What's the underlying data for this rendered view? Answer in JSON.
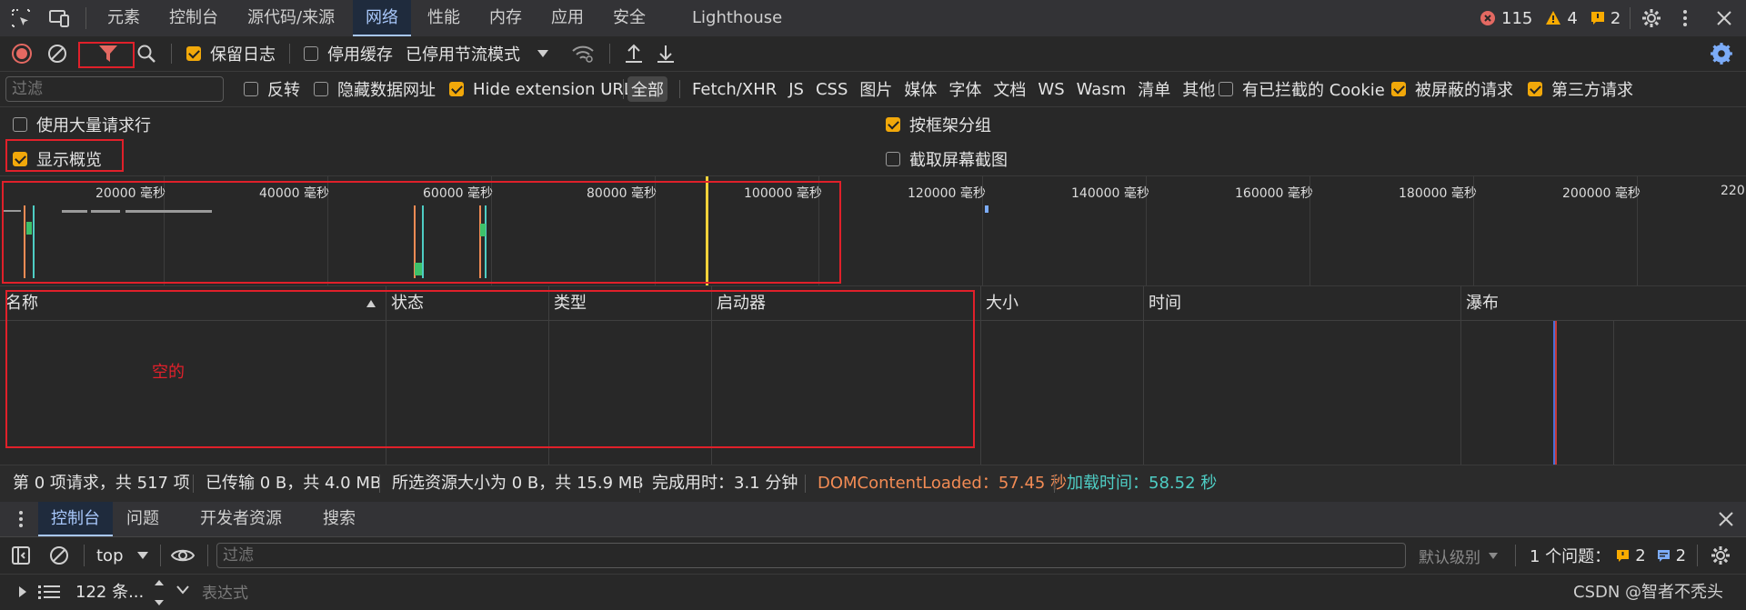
{
  "tabs": [
    {
      "label": "元素"
    },
    {
      "label": "控制台"
    },
    {
      "label": "源代码/来源"
    },
    {
      "label": "网络"
    },
    {
      "label": "性能"
    },
    {
      "label": "内存"
    },
    {
      "label": "应用"
    },
    {
      "label": "安全"
    },
    {
      "label": "Lighthouse"
    }
  ],
  "badges": {
    "errors": "115",
    "warnings": "4",
    "info": "2"
  },
  "toolbar": {
    "preserve_log": "保留日志",
    "disable_cache": "停用缓存",
    "throttle": "已停用节流模式"
  },
  "filter": {
    "placeholder": "过滤",
    "invert": "反转",
    "hide_data_urls": "隐藏数据网址",
    "hide_ext": "Hide extension URLs",
    "types": [
      "全部",
      "Fetch/XHR",
      "JS",
      "CSS",
      "图片",
      "媒体",
      "字体",
      "文档",
      "WS",
      "Wasm",
      "清单",
      "其他"
    ],
    "blocked_cookies": "有已拦截的 Cookie",
    "blocked_requests": "被屏蔽的请求",
    "third_party": "第三方请求"
  },
  "options": {
    "large_rows": "使用大量请求行",
    "group_by_frame": "按框架分组",
    "show_overview": "显示概览",
    "capture_screenshots": "截取屏幕截图"
  },
  "overview": {
    "ticks": [
      "20000 毫秒",
      "40000 毫秒",
      "60000 毫秒",
      "80000 毫秒",
      "100000 毫秒",
      "120000 毫秒",
      "140000 毫秒",
      "160000 毫秒",
      "180000 毫秒",
      "200000 毫秒",
      "220"
    ]
  },
  "table": {
    "headers": [
      "名称",
      "状态",
      "类型",
      "启动器",
      "大小",
      "时间",
      "瀑布"
    ],
    "empty": "空的"
  },
  "status": {
    "requests": "第 0 项请求，共 517 项",
    "transferred": "已传输 0 B，共 4.0 MB",
    "resources": "所选资源大小为 0 B，共 15.9 MB",
    "finish": "完成用时：3.1 分钟",
    "dcl": "DOMContentLoaded：57.45 秒",
    "load": "加载时间：58.52 秒",
    "dcl_color": "#f28b54",
    "load_color": "#4ecdc4"
  },
  "drawer": {
    "tabs": [
      "控制台",
      "问题",
      "开发者资源",
      "搜索"
    ],
    "context": "top",
    "filter_placeholder": "过滤",
    "level": "默认级别",
    "issues_label": "1 个问题：",
    "issues_warn": "2",
    "issues_info": "2",
    "messages": "122 条...",
    "expression": "表达式",
    "watermark": "CSDN @智者不秃头"
  }
}
